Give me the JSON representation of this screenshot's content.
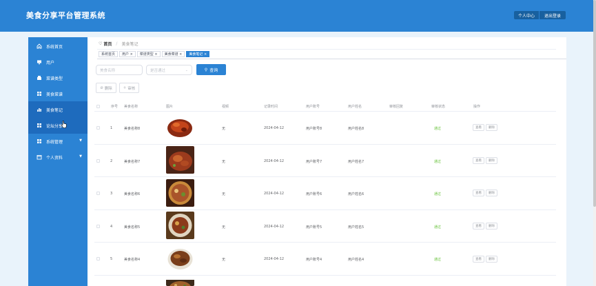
{
  "app": {
    "title": "美食分享平台管理系统"
  },
  "header": {
    "user_center": "个人中心",
    "logout": "退出登录"
  },
  "sidebar": {
    "items": [
      {
        "label": "系统首页",
        "icon": "home-icon"
      },
      {
        "label": "用户",
        "icon": "monitor-icon"
      },
      {
        "label": "菜谱类型",
        "icon": "tray-icon"
      },
      {
        "label": "美食菜谱",
        "icon": "grid-icon"
      },
      {
        "label": "美食笔记",
        "icon": "bar-chart-icon"
      },
      {
        "label": "论坛分享",
        "icon": "grid-icon"
      },
      {
        "label": "系统管理",
        "icon": "grid-icon"
      },
      {
        "label": "个人资料",
        "icon": "calendar-icon"
      }
    ]
  },
  "breadcrumb": {
    "home": "首页",
    "current": "美食笔记"
  },
  "tags": [
    "系统首页",
    "用户 ×",
    "菜谱类型 ×",
    "美食菜谱 ×",
    "美食笔记 ×"
  ],
  "search": {
    "name_placeholder": "美食名称",
    "status_placeholder": "是否通过",
    "button": "查询"
  },
  "actions": {
    "delete": "删除",
    "review": "审核"
  },
  "table": {
    "headers": [
      "序号",
      "美食名称",
      "图片",
      "视频",
      "记录时间",
      "用户账号",
      "用户姓名",
      "审核回复",
      "审核状态",
      "操作"
    ],
    "rows": [
      {
        "index": "1",
        "name": "美食名称8",
        "video": "无",
        "time": "2024-04-12",
        "account": "用户账号8",
        "username": "用户姓名8",
        "reply": "",
        "status": "通过"
      },
      {
        "index": "2",
        "name": "美食名称7",
        "video": "无",
        "time": "2024-04-12",
        "account": "用户账号7",
        "username": "用户姓名7",
        "reply": "",
        "status": "通过"
      },
      {
        "index": "3",
        "name": "美食名称6",
        "video": "无",
        "time": "2024-04-12",
        "account": "用户账号6",
        "username": "用户姓名6",
        "reply": "",
        "status": "通过"
      },
      {
        "index": "4",
        "name": "美食名称5",
        "video": "无",
        "time": "2024-04-12",
        "account": "用户账号5",
        "username": "用户姓名5",
        "reply": "",
        "status": "通过"
      },
      {
        "index": "5",
        "name": "美食名称4",
        "video": "无",
        "time": "2024-04-12",
        "account": "用户账号4",
        "username": "用户姓名4",
        "reply": "",
        "status": "通过"
      }
    ],
    "row_actions": {
      "view": "查看",
      "delete": "删除"
    }
  },
  "colors": {
    "primary": "#2b83d4",
    "sidebar_active": "#1e6bbd",
    "pass": "#67c23a"
  }
}
